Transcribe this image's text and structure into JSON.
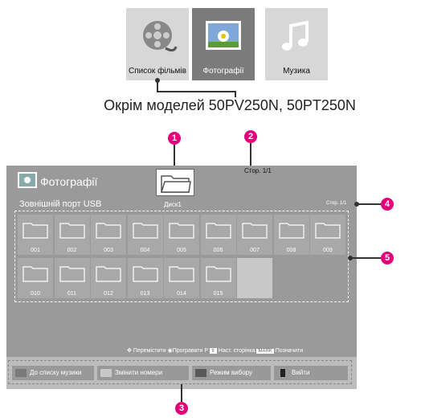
{
  "categories": [
    {
      "label": "Список фільмів",
      "icon": "film-reel-icon",
      "selected": false
    },
    {
      "label": "Фотографії",
      "icon": "photo-icon",
      "selected": true
    },
    {
      "label": "Музика",
      "icon": "music-note-icon",
      "selected": false
    }
  ],
  "caption": "Окрім моделей 50PV250N, 50PT250N",
  "screen": {
    "title": "Фотографії",
    "port": "Зовнішній порт USB",
    "disk": "Диск1",
    "page_top": "Стор. 1/1",
    "page_right": "Стор. 1/1",
    "folders": [
      "001",
      "002",
      "003",
      "004",
      "005",
      "006",
      "007",
      "008",
      "009",
      "010",
      "011",
      "012",
      "013",
      "014",
      "015"
    ],
    "hints": {
      "move": "Перемістити",
      "play": "Програвати",
      "p": "P",
      "next_page": "Наст. сторінка",
      "mark_key": "MARK",
      "mark": "Позначити"
    }
  },
  "bottom_buttons": [
    {
      "label": "До списку музики",
      "color": "#7a7a7a"
    },
    {
      "label": "Змінити номери",
      "color": "#c8c8c8"
    },
    {
      "label": "Режим вибору",
      "color": "#5a5a5a"
    },
    {
      "label": "Вийти",
      "color": "#222222"
    }
  ],
  "callouts": [
    "1",
    "2",
    "3",
    "4",
    "5"
  ],
  "colors": {
    "callout": "#e2007a",
    "screen_bg": "#9a9a9a"
  }
}
